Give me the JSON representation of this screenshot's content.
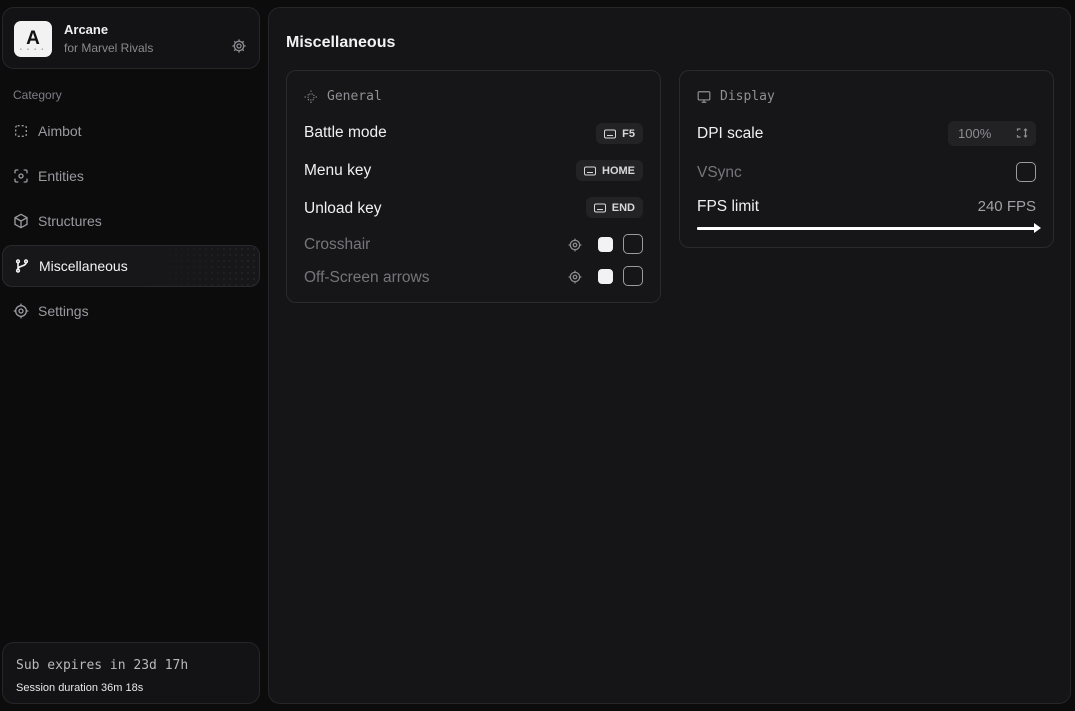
{
  "brand": {
    "name": "Arcane",
    "subtitle": "for Marvel Rivals",
    "logo_letter": "A"
  },
  "sidebar": {
    "category_label": "Category",
    "items": [
      {
        "label": "Aimbot",
        "icon": "dashed-square-icon",
        "active": false
      },
      {
        "label": "Entities",
        "icon": "scan-target-icon",
        "active": false
      },
      {
        "label": "Structures",
        "icon": "cube-icon",
        "active": false
      },
      {
        "label": "Miscellaneous",
        "icon": "git-branch-icon",
        "active": true
      },
      {
        "label": "Settings",
        "icon": "gear-icon",
        "active": false
      }
    ]
  },
  "footer": {
    "sub_expires": "Sub expires in 23d 17h",
    "session": "Session duration 36m 18s"
  },
  "main": {
    "title": "Miscellaneous",
    "general": {
      "heading": "General",
      "battle_mode": {
        "label": "Battle mode",
        "key": "F5"
      },
      "menu_key": {
        "label": "Menu key",
        "key": "HOME"
      },
      "unload_key": {
        "label": "Unload key",
        "key": "END"
      },
      "crosshair": {
        "label": "Crosshair",
        "color": "#f2f2f4",
        "enabled": false
      },
      "offscreen": {
        "label": "Off-Screen arrows",
        "color": "#f2f2f4",
        "enabled": false
      }
    },
    "display": {
      "heading": "Display",
      "dpi": {
        "label": "DPI scale",
        "value": "100%"
      },
      "vsync": {
        "label": "VSync",
        "enabled": false
      },
      "fps": {
        "label": "FPS limit",
        "value": "240 FPS",
        "fraction": 1.0
      }
    }
  },
  "colors": {
    "background": "#0c0c0d",
    "panel": "#161618",
    "accent": "#f2f2f4"
  }
}
